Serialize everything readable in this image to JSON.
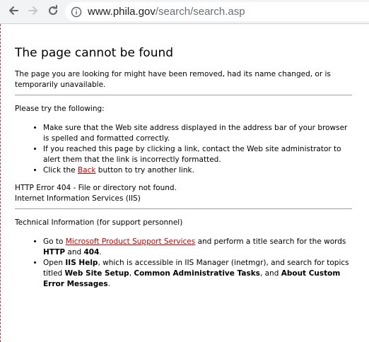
{
  "browser": {
    "address_domain": "www.phila.gov",
    "address_path": "/search/search.asp",
    "back_icon": "arrow-left-icon",
    "forward_icon": "arrow-right-icon",
    "reload_icon": "reload-icon",
    "info_icon": "info-icon"
  },
  "page": {
    "title": "The page cannot be found",
    "intro": "The page you are looking for might have been removed, had its name changed, or is temporarily unavailable.",
    "try_heading": "Please try the following:",
    "try_items": {
      "item1": "Make sure that the Web site address displayed in the address bar of your browser is spelled and formatted correctly.",
      "item2": "If you reached this page by clicking a link, contact the Web site administrator to alert them that the link is incorrectly formatted.",
      "item3_prefix": "Click the ",
      "item3_link": "Back",
      "item3_suffix": " button to try another link."
    },
    "http_error": "HTTP Error 404 - File or directory not found.",
    "server_name": "Internet Information Services (IIS)",
    "tech_heading": "Technical Information (for support personnel)",
    "tech_items": {
      "item1_prefix": "Go to ",
      "item1_link": "Microsoft Product Support Services",
      "item1_mid": " and perform a title search for the words ",
      "item1_bold1": "HTTP",
      "item1_and": " and ",
      "item1_bold2": "404",
      "item1_end": ".",
      "item2_prefix": "Open ",
      "item2_bold1": "IIS Help",
      "item2_mid": ", which is accessible in IIS Manager (inetmgr), and search for topics titled ",
      "item2_bold2": "Web Site Setup",
      "item2_comma": ", ",
      "item2_bold3": "Common Administrative Tasks",
      "item2_and": ", and ",
      "item2_bold4": "About Custom Error Messages",
      "item2_end": "."
    }
  },
  "colors": {
    "link": "#cc0000",
    "toolbar_bg": "#f1f3f4"
  }
}
